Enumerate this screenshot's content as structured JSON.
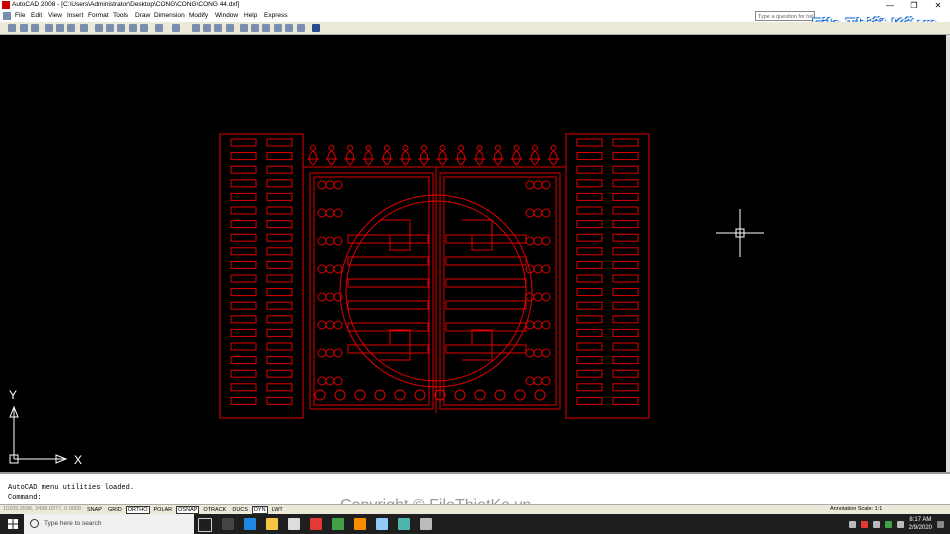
{
  "window": {
    "title": "AutoCAD 2008 - [C:\\Users\\Administrator\\Desktop\\CONG\\CONG\\CONG 44.dxf]",
    "minimize": "—",
    "maximize": "❐",
    "close": "✕"
  },
  "menu": {
    "items": [
      "File",
      "Edit",
      "View",
      "Insert",
      "Format",
      "Tools",
      "Draw",
      "Dimension",
      "Modify",
      "Window",
      "Help",
      "Express"
    ]
  },
  "help": {
    "question_placeholder": "Type a question for help"
  },
  "logo": {
    "text": "File Thiết Kế.vn"
  },
  "axes": {
    "y_label": "Y",
    "x_label": "X"
  },
  "command": {
    "history": "AutoCAD menu utilities loaded.",
    "prompt": "Command:"
  },
  "watermark": "Copyright © FileThietKe.vn",
  "status": {
    "coords": "10205.0596, 3498.0377, 0.0000",
    "toggles": [
      {
        "label": "SNAP",
        "on": false
      },
      {
        "label": "GRID",
        "on": false
      },
      {
        "label": "ORTHO",
        "on": true
      },
      {
        "label": "POLAR",
        "on": false
      },
      {
        "label": "OSNAP",
        "on": true
      },
      {
        "label": "OTRACK",
        "on": false
      },
      {
        "label": "DUCS",
        "on": false
      },
      {
        "label": "DYN",
        "on": true
      },
      {
        "label": "LWT",
        "on": false
      }
    ],
    "annotation_scale_label": "Annotation Scale:",
    "annotation_scale_value": "1:1"
  },
  "taskbar": {
    "search_placeholder": "Type here to search",
    "time": "8:17 AM",
    "date": "2/9/2020"
  },
  "colors": {
    "drawing": "#e00000",
    "canvas": "#000000",
    "crosshair": "#ffffff"
  }
}
